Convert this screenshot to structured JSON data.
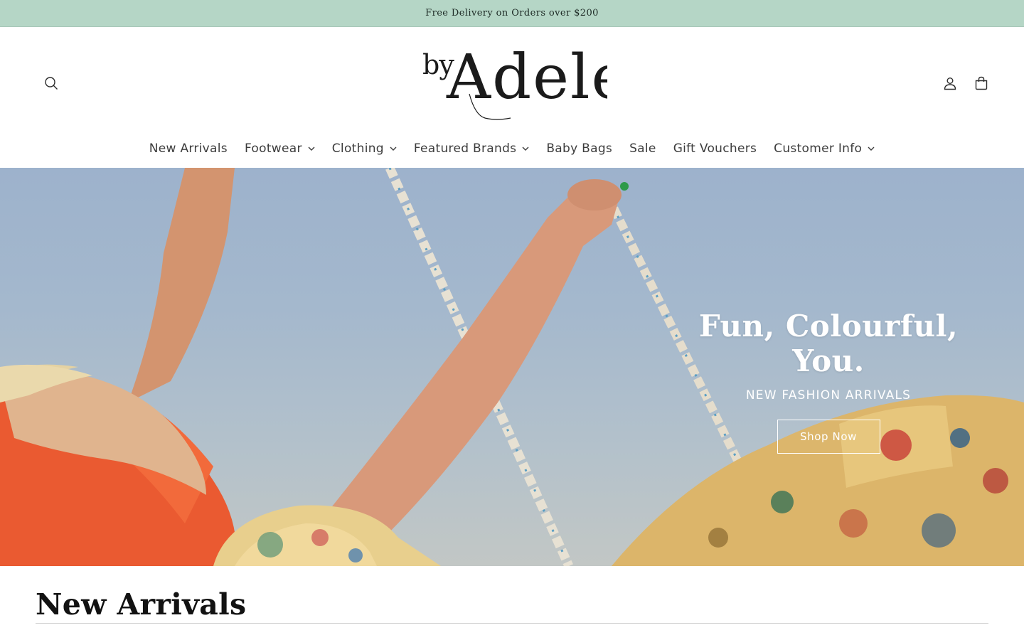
{
  "announcement": {
    "text": "Free Delivery on Orders over $200"
  },
  "header": {
    "logo": {
      "prefix": "by",
      "name": "Adele"
    },
    "icons": {
      "search": "search-icon",
      "account": "account-icon",
      "cart": "cart-icon"
    }
  },
  "nav": {
    "items": [
      {
        "label": "New Arrivals",
        "has_dropdown": false
      },
      {
        "label": "Footwear",
        "has_dropdown": true
      },
      {
        "label": "Clothing",
        "has_dropdown": true
      },
      {
        "label": "Featured Brands",
        "has_dropdown": true
      },
      {
        "label": "Baby Bags",
        "has_dropdown": false
      },
      {
        "label": "Sale",
        "has_dropdown": false
      },
      {
        "label": "Gift Vouchers",
        "has_dropdown": false
      },
      {
        "label": "Customer Info",
        "has_dropdown": true
      }
    ]
  },
  "hero": {
    "title": "Fun, Colourful, You.",
    "subtitle": "NEW FASHION ARRIVALS",
    "cta": "Shop Now"
  },
  "section": {
    "title": "New Arrivals"
  },
  "colors": {
    "announcement_bg": "#b5d6c6",
    "text": "#222222",
    "hero_text": "#ffffff"
  }
}
